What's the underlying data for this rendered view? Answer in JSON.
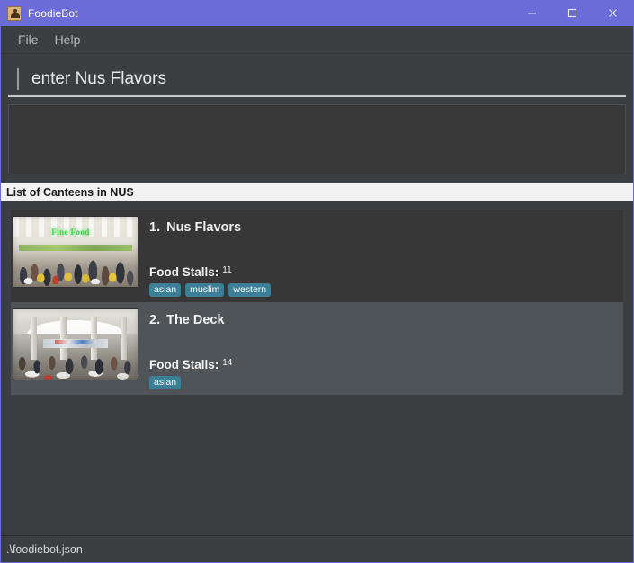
{
  "window": {
    "title": "FoodieBot",
    "icon": "app-icon",
    "accent_color": "#6b6cd8",
    "controls": {
      "minimize": "minimize-icon",
      "maximize": "maximize-icon",
      "close": "close-icon"
    }
  },
  "menubar": {
    "items": [
      {
        "label": "File"
      },
      {
        "label": "Help"
      }
    ]
  },
  "search": {
    "value": "enter Nus Flavors",
    "placeholder": "enter Nus Flavors"
  },
  "output": {
    "text": ""
  },
  "section": {
    "header": "List of Canteens in NUS"
  },
  "list": {
    "items": [
      {
        "index": "1.",
        "name": "Nus Flavors",
        "thumbnail": "nus-flavors-food-court-photo",
        "stalls_label": "Food Stalls:",
        "stalls_count": "11",
        "tags": [
          "asian",
          "muslim",
          "western"
        ],
        "selected": false
      },
      {
        "index": "2.",
        "name": "The Deck",
        "thumbnail": "the-deck-canteen-photo",
        "stalls_label": "Food Stalls:",
        "stalls_count": "14",
        "tags": [
          "asian"
        ],
        "selected": true
      }
    ]
  },
  "statusbar": {
    "text": ".\\foodiebot.json"
  },
  "colors": {
    "titlebar": "#6b6cd8",
    "window_bg": "#3c3f41",
    "row_base": "#373737",
    "row_selected": "#4f5459",
    "tag": "#3d7f96",
    "section_header_bg": "#f2f2f2"
  }
}
